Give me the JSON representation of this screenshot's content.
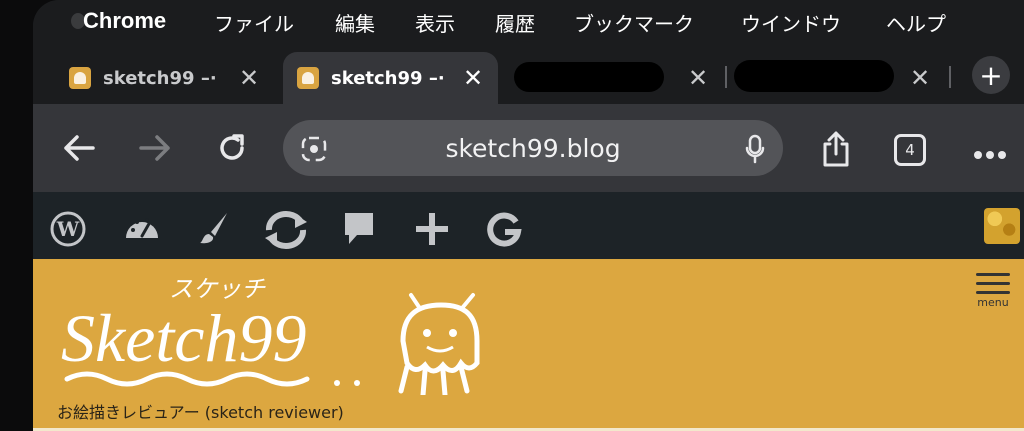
{
  "menubar": {
    "app": "Chrome",
    "items": [
      "ファイル",
      "編集",
      "表示",
      "履歴",
      "ブックマーク",
      "ウインドウ",
      "ヘルプ"
    ]
  },
  "tabs": [
    {
      "title": "sketch99 –·",
      "active": false
    },
    {
      "title": "sketch99 –·",
      "active": true
    },
    {
      "title": "",
      "redacted": true
    },
    {
      "title": "",
      "redacted": true
    }
  ],
  "toolbar": {
    "url": "sketch99.blog",
    "tab_count": "4"
  },
  "adminbar": {
    "icons": [
      "wordpress-icon",
      "dashboard-icon",
      "customize-brush-icon",
      "updates-icon",
      "comments-icon",
      "new-content-icon",
      "google-icon"
    ]
  },
  "site": {
    "logo_kana": "スケッチ",
    "logo_text": "Sketch99",
    "tagline": "お絵描きレビュアー (sketch reviewer)",
    "menu_label": "menu"
  },
  "colors": {
    "site_header": "#dca740",
    "admin_bar": "#1d2327",
    "toolbar": "#35363a"
  }
}
